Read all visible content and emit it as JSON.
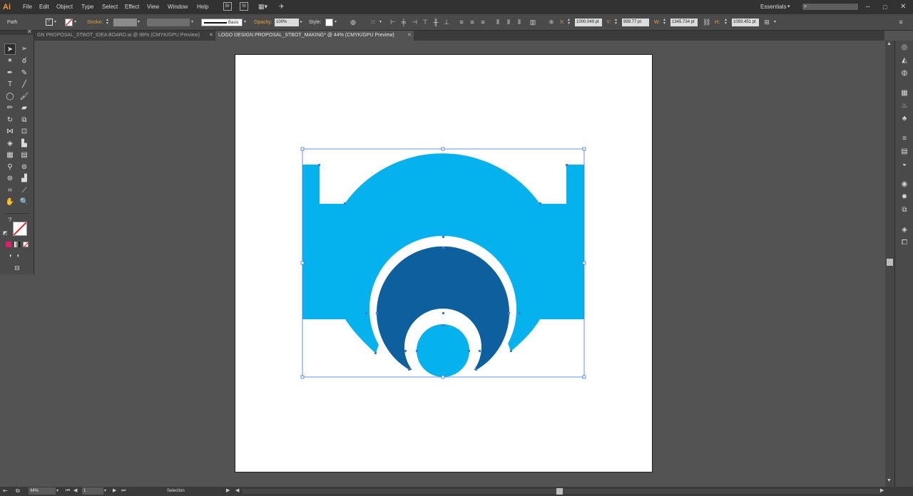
{
  "app": {
    "logo": "Ai",
    "workspace": "Essentials",
    "search_placeholder": ""
  },
  "menu": [
    "File",
    "Edit",
    "Object",
    "Type",
    "Select",
    "Effect",
    "View",
    "Window",
    "Help"
  ],
  "menu_icons": [
    "bridge-icon",
    "stock-icon",
    "arrange-documents-icon",
    "gpu-performance-icon"
  ],
  "control": {
    "selection_type": "Path",
    "stroke_label": "Stroke:",
    "brush_label": "Basic",
    "opacity_label": "Opacity:",
    "opacity_value": "100%",
    "style_label": "Style:",
    "x_label": "X:",
    "x_value": "1000.049 pt",
    "y_label": "Y:",
    "y_value": "999.77 pt",
    "w_label": "W:",
    "w_value": "1345.734 pt",
    "h_label": "H:",
    "h_value": "1093.451 pt"
  },
  "tabs": [
    {
      "label": "GN PROPOSAL_STBOT_IDEA BOARD.ai @ 88% (CMYK/GPU Preview)",
      "active": false
    },
    {
      "label": "LOGO DESIGN PROPOSAL_STBOT_MAKING* @ 44% (CMYK/GPU Preview)",
      "active": true
    }
  ],
  "status": {
    "zoom": "44%",
    "artboard_num": "1",
    "tool_name": "Selection"
  },
  "colors": {
    "fill_light": "#05b2ee",
    "fill_dark": "#0e5f9e",
    "selection": "#3c78e6",
    "artboard": "#ffffff",
    "canvas": "#535353"
  }
}
